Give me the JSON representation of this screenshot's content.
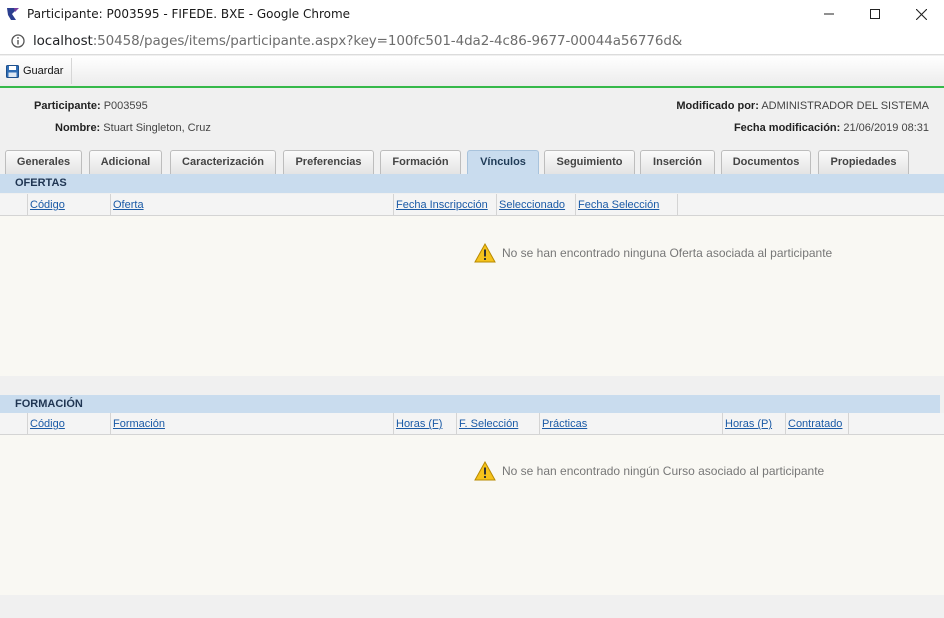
{
  "window": {
    "title": "Participante: P003595 - FIFEDE. BXE - Google Chrome"
  },
  "address": {
    "host": "localhost",
    "rest": ":50458/pages/items/participante.aspx?key=100fc501-4da2-4c86-9677-00044a56776d&"
  },
  "toolbar": {
    "save_label": "Guardar"
  },
  "header": {
    "participante_label": "Participante:",
    "participante_value": "P003595",
    "nombre_label": "Nombre:",
    "nombre_value": "Stuart Singleton, Cruz",
    "modificado_label": "Modificado por:",
    "modificado_value": "ADMINISTRADOR DEL SISTEMA",
    "fecha_label": "Fecha modificación:",
    "fecha_value": "21/06/2019 08:31"
  },
  "tabs": [
    {
      "label": "Generales",
      "active": false
    },
    {
      "label": "Adicional",
      "active": false
    },
    {
      "label": "Caracterización",
      "active": false
    },
    {
      "label": "Preferencias",
      "active": false
    },
    {
      "label": "Formación",
      "active": false
    },
    {
      "label": "Vínculos",
      "active": true
    },
    {
      "label": "Seguimiento",
      "active": false
    },
    {
      "label": "Inserción",
      "active": false
    },
    {
      "label": "Documentos",
      "active": false
    },
    {
      "label": "Propiedades",
      "active": false
    }
  ],
  "ofertas": {
    "title": "OFERTAS",
    "columns": [
      "Código",
      "Oferta",
      "Fecha Inscripcción",
      "Seleccionado",
      "Fecha Selección"
    ],
    "empty_message": "No se han encontrado ninguna Oferta asociada al participante"
  },
  "formacion": {
    "title": "FORMACIÓN",
    "columns": [
      "Código",
      "Formación",
      "Horas (F)",
      "F. Selección",
      "Prácticas",
      "Horas (P)",
      "Contratado"
    ],
    "empty_message": "No se han encontrado ningún Curso asociado al participante"
  },
  "colors": {
    "accent_green": "#36b94a",
    "section_blue": "#c9dcee",
    "link_blue": "#1a5aa6",
    "warning_yellow": "#f5c21b"
  }
}
